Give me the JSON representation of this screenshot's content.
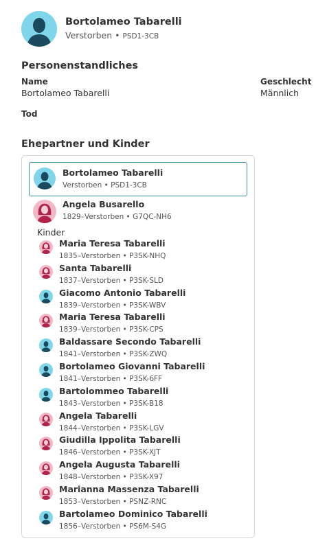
{
  "person": {
    "name": "Bortolameo Tabarelli",
    "status": "Verstorben",
    "separator": " • ",
    "pid": "PSD1-3CB"
  },
  "vitals": {
    "title": "Personenstandliches",
    "name_label": "Name",
    "name_value": "Bortolameo Tabarelli",
    "gender_label": "Geschlecht",
    "gender_value": "Männlich",
    "death_label": "Tod"
  },
  "family": {
    "title": "Ehepartner und Kinder",
    "selected": {
      "name": "Bortolameo Tabarelli",
      "sub": "Verstorben • PSD1-3CB",
      "gender": "male"
    },
    "spouse": {
      "name": "Angela Busarello",
      "sub": "1829–Verstorben • G7QC-NH6",
      "gender": "female"
    },
    "children_label": "Kinder",
    "children": [
      {
        "name": "Maria Teresa Tabarelli",
        "sub": "1835–Verstorben • P3SK-NHQ",
        "gender": "female"
      },
      {
        "name": "Santa Tabarelli",
        "sub": "1837–Verstorben • P3SK-SLD",
        "gender": "female"
      },
      {
        "name": "Giacomo Antonio Tabarelli",
        "sub": "1839–Verstorben • P3SK-WBV",
        "gender": "male"
      },
      {
        "name": "Maria Teresa Tabarelli",
        "sub": "1839–Verstorben • P3SK-CPS",
        "gender": "female"
      },
      {
        "name": "Baldassare Secondo Tabarelli",
        "sub": "1841–Verstorben • P3SK-ZWQ",
        "gender": "male"
      },
      {
        "name": "Bortolameo Giovanni Tabarelli",
        "sub": "1841–Verstorben • P3SK-6FF",
        "gender": "male"
      },
      {
        "name": "Bartolommeo Tabarelli",
        "sub": "1843–Verstorben • P3SK-B18",
        "gender": "male"
      },
      {
        "name": "Angela Tabarelli",
        "sub": "1844–Verstorben • P3SK-LGV",
        "gender": "female"
      },
      {
        "name": "Giudilla Ippolita Tabarelli",
        "sub": "1846–Verstorben • P3SK-XJT",
        "gender": "female"
      },
      {
        "name": "Angela Augusta Tabarelli",
        "sub": "1848–Verstorben • P3SK-X97",
        "gender": "female"
      },
      {
        "name": "Marianna Massenza Tabarelli",
        "sub": "1853–Verstorben • PSNZ-RNC",
        "gender": "female"
      },
      {
        "name": "Bartolameo Dominico Tabarelli",
        "sub": "1856–Verstorben • PS6M-S4G",
        "gender": "male"
      }
    ]
  },
  "colors": {
    "male_bg": "#7fd6ea",
    "male_fg": "#1b4a5e",
    "female_bg": "#f2b8c6",
    "female_fg": "#b0234a",
    "selected_border": "#3c8da6"
  }
}
